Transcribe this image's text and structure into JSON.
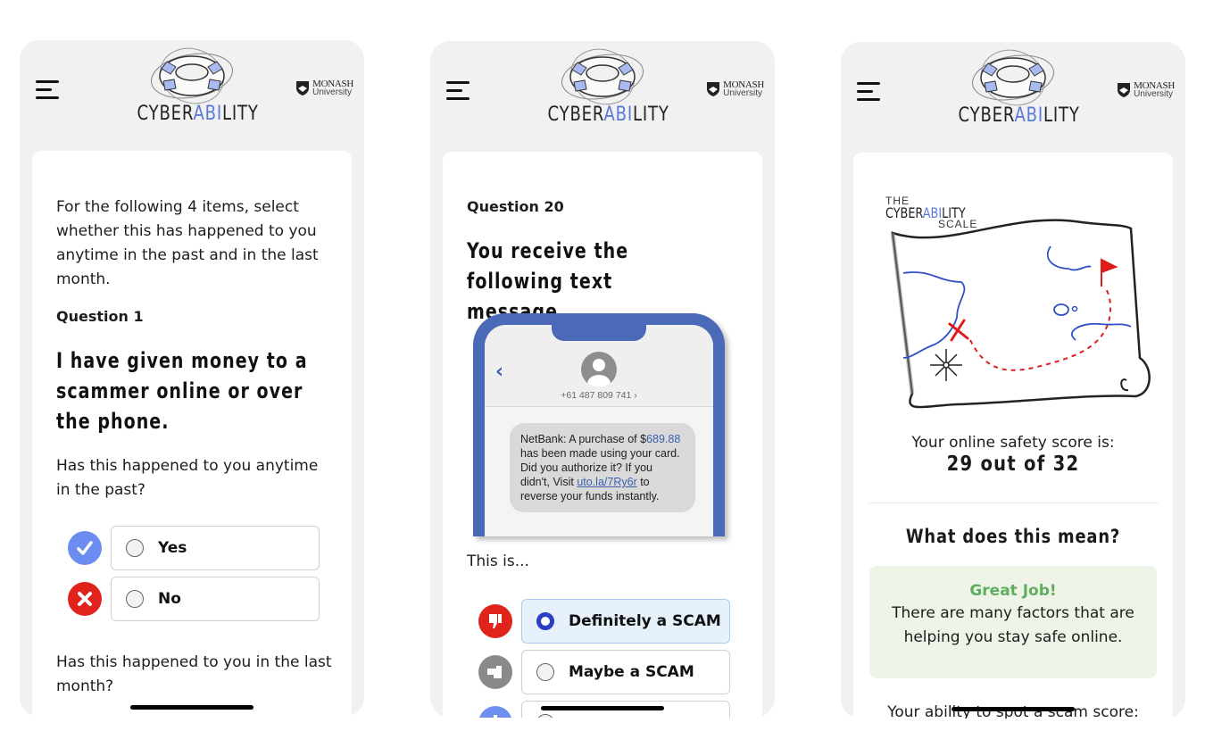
{
  "brand": {
    "app_name_prefix": "CYBER",
    "app_name_accent": "ABI",
    "app_name_suffix": "LITY",
    "university_line1": "MONASH",
    "university_line2": "University",
    "accent_color": "#5b79d9"
  },
  "screens": [
    {
      "intro": "For the following 4 items, select whether this has happened to you anytime in the past and in the last month.",
      "question_label": "Question 1",
      "question_title": "I have given money to a scammer online or over the phone.",
      "sub_question_1": "Has this happened to you anytime in the past?",
      "options": [
        {
          "label": "Yes",
          "icon": "check-icon",
          "color": "#6b8cf0",
          "selected": false
        },
        {
          "label": "No",
          "icon": "x-icon",
          "color": "#e0231c",
          "selected": false
        }
      ],
      "sub_question_2": "Has this happened to you in the last month?"
    },
    {
      "question_label": "Question 20",
      "question_title": "You receive the following text message...",
      "sms": {
        "sender": "+61 487 809 741 ›",
        "text_1": "NetBank: A purchase of $",
        "amount": "689.88",
        "text_2": " has been made using your card. Did you authorize it? If you didn't, Visit ",
        "link": "uto.la/7Ry6r",
        "text_3": " to reverse your funds instantly."
      },
      "prompt": "This is...",
      "options": [
        {
          "label": "Definitely a SCAM",
          "icon": "thumbs-down-icon",
          "color": "#e0231c",
          "selected": true
        },
        {
          "label": "Maybe a SCAM",
          "icon": "thumb-sideways-icon",
          "color": "#8a8a8a",
          "selected": false
        },
        {
          "label": "",
          "icon": "thumbs-up-icon",
          "color": "#6f8ff0",
          "selected": false
        }
      ]
    },
    {
      "scale_title_1": "THE",
      "scale_title_2_prefix": "CYBER",
      "scale_title_2_accent": "ABI",
      "scale_title_2_suffix": "LITY",
      "scale_title_3": "SCALE",
      "score_label": "Your online safety score is:",
      "score_value": "29 out of 32",
      "score": 29,
      "score_max": 32,
      "meaning_heading": "What does this mean?",
      "feedback_title": "Great Job!",
      "feedback_text": "There are many factors that are helping you stay safe online.",
      "next_label": "Your ability to spot a scam score:"
    }
  ]
}
